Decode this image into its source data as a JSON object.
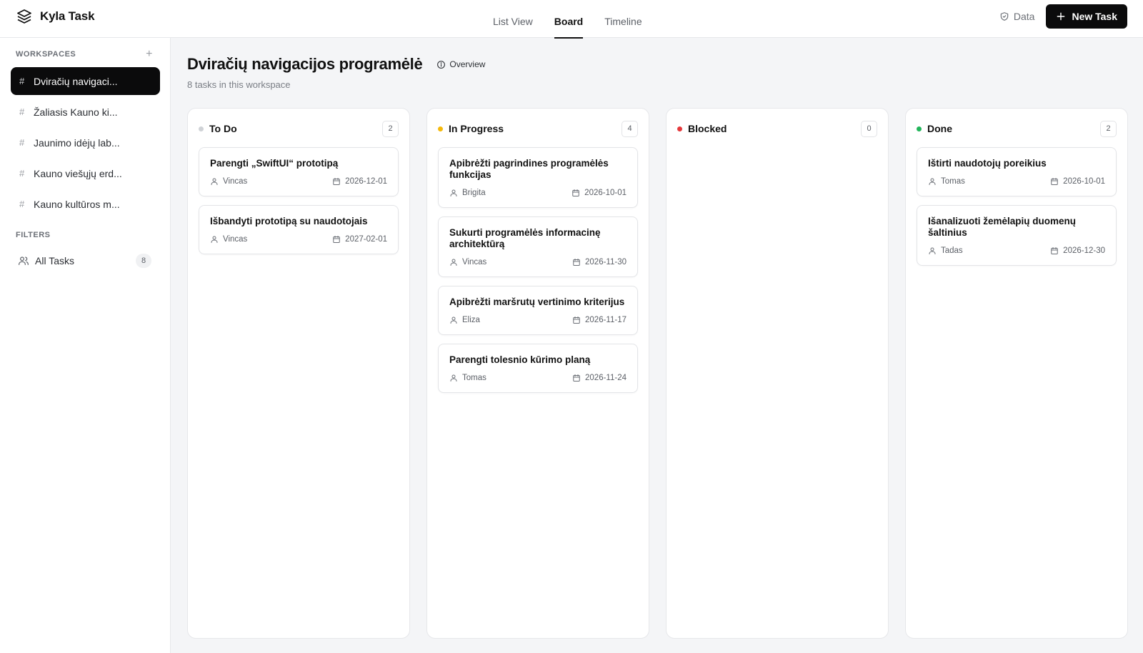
{
  "app": {
    "name": "Kyla Task"
  },
  "nav": {
    "tabs": [
      {
        "label": "List View"
      },
      {
        "label": "Board",
        "active": true
      },
      {
        "label": "Timeline"
      }
    ]
  },
  "header": {
    "data_label": "Data",
    "new_task_label": "New Task"
  },
  "sidebar": {
    "workspaces_heading": "WORKSPACES",
    "add_icon": "+",
    "workspaces": [
      {
        "label": "Dviračių navigaci...",
        "active": true
      },
      {
        "label": "Žaliasis Kauno ki..."
      },
      {
        "label": "Jaunimo idėjų lab..."
      },
      {
        "label": "Kauno viešųjų erd..."
      },
      {
        "label": "Kauno kultūros m..."
      }
    ],
    "filters_heading": "FILTERS",
    "filter": {
      "label": "All Tasks",
      "count": "8"
    }
  },
  "main": {
    "title": "Dviračių navigacijos programėlė",
    "overview_label": "Overview",
    "subtitle": "8 tasks in this workspace"
  },
  "columns": [
    {
      "title": "To Do",
      "count": "2",
      "color": "#cfd2d6",
      "cards": [
        {
          "title": "Parengti „SwiftUI“ prototipą",
          "assignee": "Vincas",
          "date": "2026-12-01"
        },
        {
          "title": "Išbandyti prototipą su naudotojais",
          "assignee": "Vincas",
          "date": "2027-02-01"
        }
      ]
    },
    {
      "title": "In Progress",
      "count": "4",
      "color": "#f5b90b",
      "cards": [
        {
          "title": "Apibrėžti pagrindines programėlės funkcijas",
          "assignee": "Brigita",
          "date": "2026-10-01"
        },
        {
          "title": "Sukurti programėlės informacinę architektūrą",
          "assignee": "Vincas",
          "date": "2026-11-30"
        },
        {
          "title": "Apibrėžti maršrutų vertinimo kriterijus",
          "assignee": "Eliza",
          "date": "2026-11-17"
        },
        {
          "title": "Parengti tolesnio kūrimo planą",
          "assignee": "Tomas",
          "date": "2026-11-24"
        }
      ]
    },
    {
      "title": "Blocked",
      "count": "0",
      "color": "#e5383b",
      "cards": []
    },
    {
      "title": "Done",
      "count": "2",
      "color": "#22b55a",
      "cards": [
        {
          "title": "Ištirti naudotojų poreikius",
          "assignee": "Tomas",
          "date": "2026-10-01"
        },
        {
          "title": "Išanalizuoti žemėlapių duomenų šaltinius",
          "assignee": "Tadas",
          "date": "2026-12-30"
        }
      ]
    }
  ]
}
